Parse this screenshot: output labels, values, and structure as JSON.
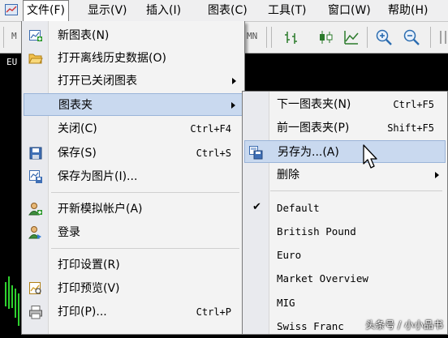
{
  "menubar": {
    "items": [
      {
        "label": "文件(F)"
      },
      {
        "label": "显示(V)"
      },
      {
        "label": "插入(I)"
      },
      {
        "label": "图表(C)"
      },
      {
        "label": "工具(T)"
      },
      {
        "label": "窗口(W)"
      },
      {
        "label": "帮助(H)"
      }
    ]
  },
  "toolbar": {
    "left_fragment": "M",
    "mid_fragment": "MN"
  },
  "chart": {
    "symbol": "EU"
  },
  "file_menu": {
    "items": [
      {
        "label": "新图表(N)",
        "icon": "new-chart-icon"
      },
      {
        "label": "打开离线历史数据(O)",
        "icon": "open-folder-icon"
      },
      {
        "label": "打开已关闭图表",
        "submenu": true
      },
      {
        "label": "图表夹",
        "submenu": true,
        "highlighted": true
      },
      {
        "label": "关闭(C)",
        "shortcut": "Ctrl+F4"
      },
      {
        "label": "保存(S)",
        "shortcut": "Ctrl+S",
        "icon": "save-icon"
      },
      {
        "label": "保存为图片(I)...",
        "icon": "save-picture-icon"
      },
      {
        "label": "开新模拟帐户(A)",
        "icon": "add-account-icon"
      },
      {
        "label": "登录",
        "icon": "login-icon"
      },
      {
        "label": "打印设置(R)"
      },
      {
        "label": "打印预览(V)",
        "icon": "print-preview-icon"
      },
      {
        "label": "打印(P)...",
        "shortcut": "Ctrl+P",
        "icon": "printer-icon"
      }
    ]
  },
  "profiles_submenu": {
    "items": [
      {
        "label": "下一图表夹(N)",
        "shortcut": "Ctrl+F5"
      },
      {
        "label": "前一图表夹(P)",
        "shortcut": "Shift+F5"
      },
      {
        "label": "另存为...(A)",
        "highlighted": true,
        "icon": "save-as-icon"
      },
      {
        "label": "删除",
        "submenu": true
      },
      {
        "label": "Default",
        "checked": true
      },
      {
        "label": "British Pound"
      },
      {
        "label": "Euro"
      },
      {
        "label": "Market Overview"
      },
      {
        "label": "MIG"
      },
      {
        "label": "Swiss Franc"
      }
    ]
  },
  "watermark": "头条号 / 小小品书"
}
